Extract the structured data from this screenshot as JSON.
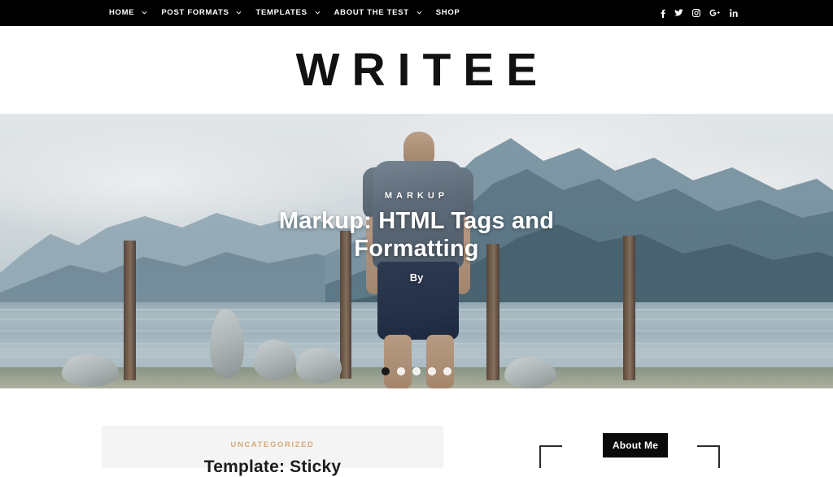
{
  "site": {
    "logo": "WRITEE"
  },
  "nav": {
    "items": [
      {
        "label": "HOME",
        "has_dropdown": true
      },
      {
        "label": "POST FORMATS",
        "has_dropdown": true
      },
      {
        "label": "TEMPLATES",
        "has_dropdown": true
      },
      {
        "label": "ABOUT THE TEST",
        "has_dropdown": true
      },
      {
        "label": "SHOP",
        "has_dropdown": false
      }
    ],
    "social": [
      {
        "name": "facebook-icon",
        "glyph": "f"
      },
      {
        "name": "twitter-icon",
        "glyph": "t"
      },
      {
        "name": "instagram-icon",
        "glyph": "i"
      },
      {
        "name": "google-plus-icon",
        "glyph": "G+"
      },
      {
        "name": "linkedin-icon",
        "glyph": "in"
      }
    ]
  },
  "hero": {
    "category": "MARKUP",
    "title": "Markup: HTML Tags and Formatting",
    "byline": "By",
    "slides_total": 5,
    "active_slide": 1
  },
  "main": {
    "post": {
      "category": "UNCATEGORIZED",
      "title": "Template: Sticky"
    }
  },
  "sidebar": {
    "about_widget": {
      "title": "About Me"
    }
  },
  "colors": {
    "header_bg": "#000000",
    "accent_category": "#d7a878",
    "card_bg": "#f4f4f4",
    "badge_bg": "#0a0a0a",
    "text": "#1b1b1b"
  }
}
